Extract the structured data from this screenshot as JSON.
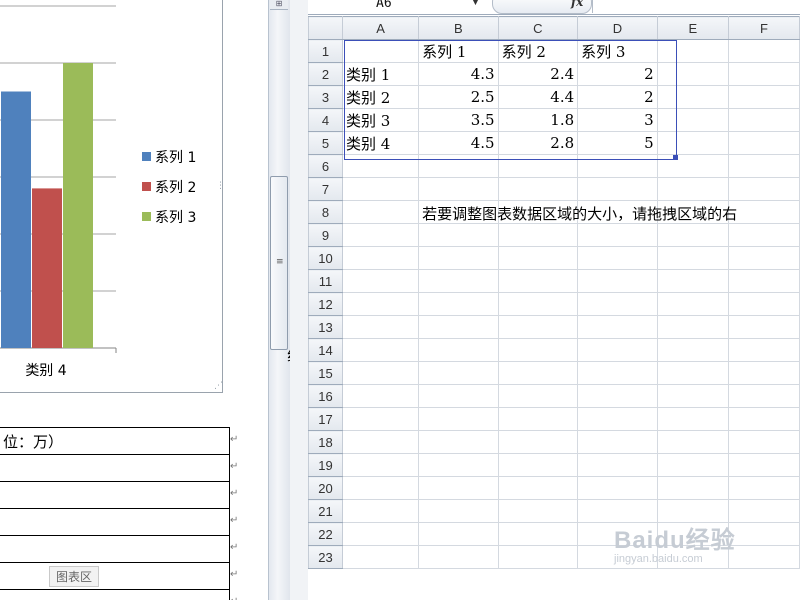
{
  "word": {
    "legend": [
      {
        "label": "系列 1",
        "color": "#4f81bd"
      },
      {
        "label": "系列 2",
        "color": "#c0504d"
      },
      {
        "label": "系列 3",
        "color": "#9bbb59"
      }
    ],
    "visible_category_label": "类别 4",
    "doc_table_rows": [
      "位：万）",
      "",
      "",
      "",
      "",
      "",
      ""
    ],
    "chart_area_tooltip": "图表区",
    "clipped_glyph": "组"
  },
  "chart_data": {
    "type": "bar",
    "categories": [
      "类别 1",
      "类别 2",
      "类别 3",
      "类别 4"
    ],
    "series": [
      {
        "name": "系列 1",
        "values": [
          4.3,
          2.5,
          3.5,
          4.5
        ],
        "color": "#4f81bd"
      },
      {
        "name": "系列 2",
        "values": [
          2.4,
          4.4,
          1.8,
          2.8
        ],
        "color": "#c0504d"
      },
      {
        "name": "系列 3",
        "values": [
          2,
          2,
          3,
          5
        ],
        "color": "#9bbb59"
      }
    ],
    "ylim": [
      0,
      6
    ],
    "grid": true,
    "legend": "right",
    "visible_category": "类别 4"
  },
  "excel": {
    "name_box": "A6",
    "fx_label": "fx",
    "columns": [
      "A",
      "B",
      "C",
      "D",
      "E",
      "F"
    ],
    "rows": [
      {
        "n": "1",
        "cells": [
          "",
          "系列 1",
          "系列 2",
          "系列 3",
          "",
          ""
        ]
      },
      {
        "n": "2",
        "cells": [
          "类别 1",
          "4.3",
          "2.4",
          "2",
          "",
          ""
        ]
      },
      {
        "n": "3",
        "cells": [
          "类别 2",
          "2.5",
          "4.4",
          "2",
          "",
          ""
        ]
      },
      {
        "n": "4",
        "cells": [
          "类别 3",
          "3.5",
          "1.8",
          "3",
          "",
          ""
        ]
      },
      {
        "n": "5",
        "cells": [
          "类别 4",
          "4.5",
          "2.8",
          "5",
          "",
          ""
        ]
      },
      {
        "n": "6",
        "cells": [
          "",
          "",
          "",
          "",
          "",
          ""
        ]
      },
      {
        "n": "7",
        "cells": [
          "",
          "",
          "",
          "",
          "",
          ""
        ]
      },
      {
        "n": "8",
        "cells": [
          "",
          "若要调整图表数据区域的大小，请拖拽区域的右",
          "",
          "",
          "",
          ""
        ]
      },
      {
        "n": "9",
        "cells": [
          "",
          "",
          "",
          "",
          "",
          ""
        ]
      },
      {
        "n": "10",
        "cells": [
          "",
          "",
          "",
          "",
          "",
          ""
        ]
      },
      {
        "n": "11",
        "cells": [
          "",
          "",
          "",
          "",
          "",
          ""
        ]
      },
      {
        "n": "12",
        "cells": [
          "",
          "",
          "",
          "",
          "",
          ""
        ]
      },
      {
        "n": "13",
        "cells": [
          "",
          "",
          "",
          "",
          "",
          ""
        ]
      },
      {
        "n": "14",
        "cells": [
          "",
          "",
          "",
          "",
          "",
          ""
        ]
      },
      {
        "n": "15",
        "cells": [
          "",
          "",
          "",
          "",
          "",
          ""
        ]
      },
      {
        "n": "16",
        "cells": [
          "",
          "",
          "",
          "",
          "",
          ""
        ]
      },
      {
        "n": "17",
        "cells": [
          "",
          "",
          "",
          "",
          "",
          ""
        ]
      },
      {
        "n": "18",
        "cells": [
          "",
          "",
          "",
          "",
          "",
          ""
        ]
      },
      {
        "n": "19",
        "cells": [
          "",
          "",
          "",
          "",
          "",
          ""
        ]
      },
      {
        "n": "20",
        "cells": [
          "",
          "",
          "",
          "",
          "",
          ""
        ]
      },
      {
        "n": "21",
        "cells": [
          "",
          "",
          "",
          "",
          "",
          ""
        ]
      },
      {
        "n": "22",
        "cells": [
          "",
          "",
          "",
          "",
          "",
          ""
        ]
      },
      {
        "n": "23",
        "cells": [
          "",
          "",
          "",
          "",
          "",
          ""
        ]
      }
    ]
  },
  "watermark": {
    "logo": "Baidu经验",
    "url": "jingyan.baidu.com"
  }
}
